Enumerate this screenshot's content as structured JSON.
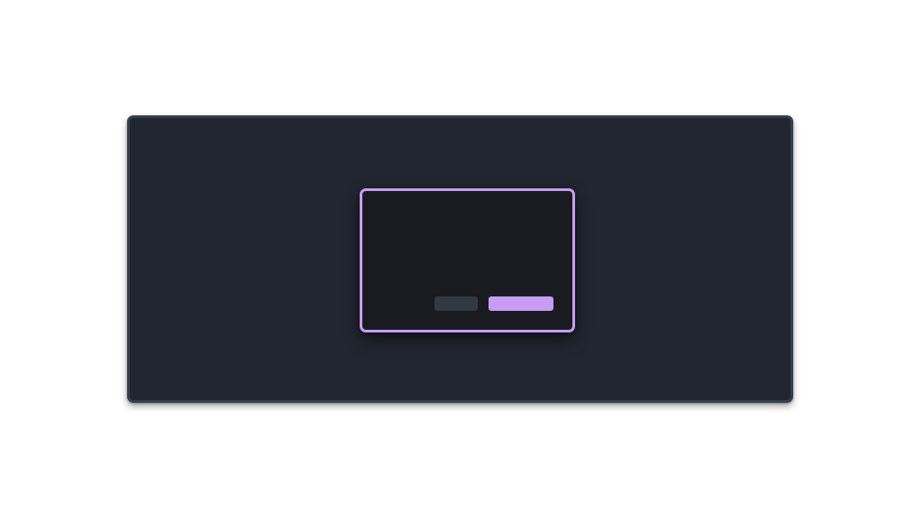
{
  "window": {
    "title": ""
  },
  "dialog": {
    "title": "",
    "message": "",
    "buttons": {
      "secondary_label": "",
      "primary_label": ""
    }
  },
  "colors": {
    "page_background": "#ffffff",
    "window_background": "#212630",
    "window_border": "#363e4b",
    "dialog_background": "#191b21",
    "accent": "#c79cf3",
    "secondary_button": "#333a44"
  }
}
